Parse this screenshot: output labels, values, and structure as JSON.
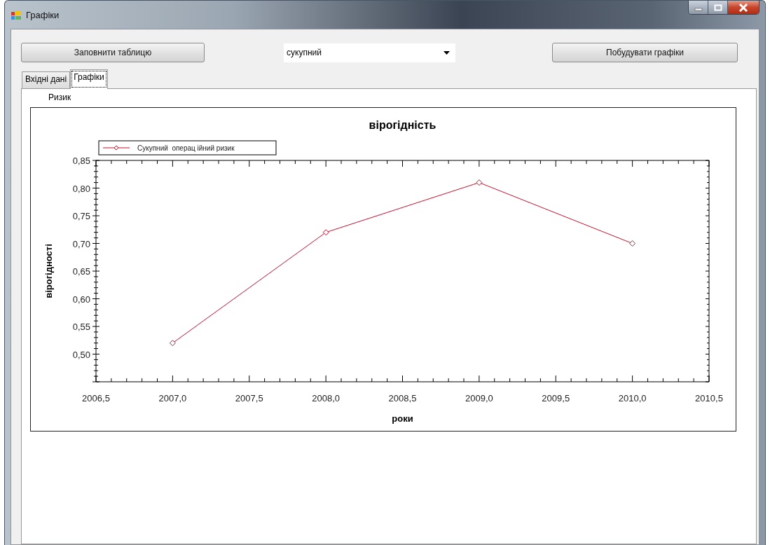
{
  "window": {
    "title": "Графіки"
  },
  "fill_button": {
    "label": "Заповнити таблицю"
  },
  "mode_select": {
    "value": "сукупний"
  },
  "build_button": {
    "label": "Побудувати графіки"
  },
  "tabs": [
    {
      "label": "Вхідні дані",
      "selected": false
    },
    {
      "label": "Графіки",
      "selected": true
    }
  ],
  "tab_page": {
    "label": "Ризик",
    "chart_data": {
      "type": "line",
      "title": "вірогідність",
      "xlabel": "роки",
      "ylabel": "вірогідності",
      "x": [
        2007,
        2008,
        2009,
        2010
      ],
      "series": [
        {
          "name": "Сукупний  операц ійний ризик",
          "color": "#c8102e",
          "marker": "diamond",
          "values": [
            0.52,
            0.72,
            0.81,
            0.7
          ]
        }
      ],
      "xlim": [
        2006.5,
        2010.5
      ],
      "ylim": [
        0.45,
        0.85
      ],
      "xticks": [
        {
          "value": 2006.5,
          "label": "2006,5"
        },
        {
          "value": 2007,
          "label": "2007,0"
        },
        {
          "value": 2007.5,
          "label": "2007,5"
        },
        {
          "value": 2008,
          "label": "2008,0"
        },
        {
          "value": 2008.5,
          "label": "2008,5"
        },
        {
          "value": 2009,
          "label": "2009,0"
        },
        {
          "value": 2009.5,
          "label": "2009,5"
        },
        {
          "value": 2010,
          "label": "2010,0"
        },
        {
          "value": 2010.5,
          "label": "2010,5"
        }
      ],
      "yticks": [
        {
          "value": 0.5,
          "label": "0,50"
        },
        {
          "value": 0.55,
          "label": "0,55"
        },
        {
          "value": 0.6,
          "label": "0,60"
        },
        {
          "value": 0.65,
          "label": "0,65"
        },
        {
          "value": 0.7,
          "label": "0,70"
        },
        {
          "value": 0.75,
          "label": "0,75"
        },
        {
          "value": 0.8,
          "label": "0,80"
        },
        {
          "value": 0.85,
          "label": "0,85"
        }
      ]
    }
  }
}
